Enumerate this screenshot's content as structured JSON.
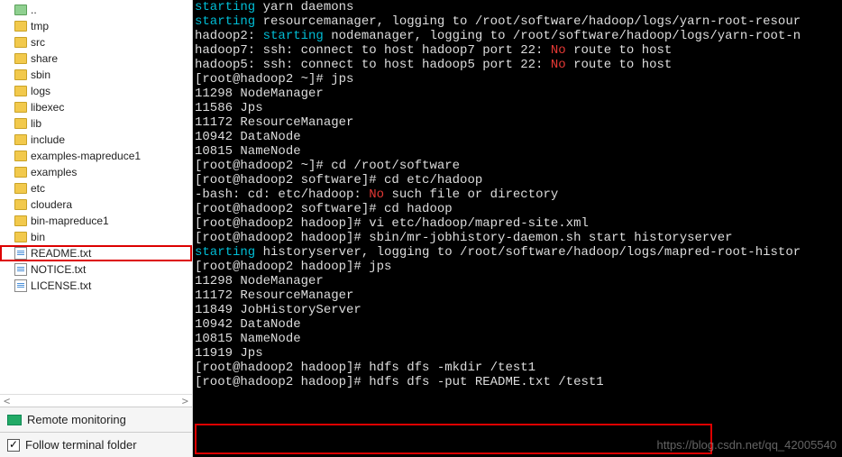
{
  "sidebar": {
    "items": [
      {
        "label": "..",
        "type": "up"
      },
      {
        "label": "tmp",
        "type": "folder"
      },
      {
        "label": "src",
        "type": "folder"
      },
      {
        "label": "share",
        "type": "folder"
      },
      {
        "label": "sbin",
        "type": "folder"
      },
      {
        "label": "logs",
        "type": "folder"
      },
      {
        "label": "libexec",
        "type": "folder"
      },
      {
        "label": "lib",
        "type": "folder"
      },
      {
        "label": "include",
        "type": "folder"
      },
      {
        "label": "examples-mapreduce1",
        "type": "folder"
      },
      {
        "label": "examples",
        "type": "folder"
      },
      {
        "label": "etc",
        "type": "folder"
      },
      {
        "label": "cloudera",
        "type": "folder"
      },
      {
        "label": "bin-mapreduce1",
        "type": "folder"
      },
      {
        "label": "bin",
        "type": "folder"
      },
      {
        "label": "README.txt",
        "type": "file",
        "highlighted": true
      },
      {
        "label": "NOTICE.txt",
        "type": "file"
      },
      {
        "label": "LICENSE.txt",
        "type": "file"
      }
    ]
  },
  "footer": {
    "remote_monitoring": "Remote monitoring",
    "follow_terminal": "Follow terminal folder"
  },
  "terminal_lines": [
    [
      {
        "t": "starting",
        "c": "cyan"
      },
      {
        "t": " yarn daemons",
        "c": "white"
      }
    ],
    [
      {
        "t": "starting",
        "c": "cyan"
      },
      {
        "t": " resourcemanager, logging to /root/software/hadoop/logs/yarn-root-resour",
        "c": "white"
      }
    ],
    [
      {
        "t": "hadoop2: ",
        "c": "white"
      },
      {
        "t": "starting",
        "c": "cyan"
      },
      {
        "t": " nodemanager, logging to /root/software/hadoop/logs/yarn-root-n",
        "c": "white"
      }
    ],
    [
      {
        "t": "hadoop7: ssh: connect to host hadoop7 port 22: ",
        "c": "white"
      },
      {
        "t": "No",
        "c": "red"
      },
      {
        "t": " route to host",
        "c": "white"
      }
    ],
    [
      {
        "t": "hadoop5: ssh: connect to host hadoop5 port 22: ",
        "c": "white"
      },
      {
        "t": "No",
        "c": "red"
      },
      {
        "t": " route to host",
        "c": "white"
      }
    ],
    [
      {
        "t": "[root@hadoop2 ~]# jps",
        "c": "white"
      }
    ],
    [
      {
        "t": "11298 NodeManager",
        "c": "white"
      }
    ],
    [
      {
        "t": "11586 Jps",
        "c": "white"
      }
    ],
    [
      {
        "t": "11172 ResourceManager",
        "c": "white"
      }
    ],
    [
      {
        "t": "10942 DataNode",
        "c": "white"
      }
    ],
    [
      {
        "t": "10815 NameNode",
        "c": "white"
      }
    ],
    [
      {
        "t": "[root@hadoop2 ~]# cd /root/software",
        "c": "white"
      }
    ],
    [
      {
        "t": "[root@hadoop2 software]# cd etc/hadoop",
        "c": "white"
      }
    ],
    [
      {
        "t": "-bash: cd: etc/hadoop: ",
        "c": "white"
      },
      {
        "t": "No",
        "c": "red"
      },
      {
        "t": " such file or directory",
        "c": "white"
      }
    ],
    [
      {
        "t": "[root@hadoop2 software]# cd hadoop",
        "c": "white"
      }
    ],
    [
      {
        "t": "[root@hadoop2 hadoop]# vi etc/hadoop/mapred-site.xml",
        "c": "white"
      }
    ],
    [
      {
        "t": "[root@hadoop2 hadoop]# sbin/mr-jobhistory-daemon.sh start historyserver",
        "c": "white"
      }
    ],
    [
      {
        "t": "starting",
        "c": "cyan"
      },
      {
        "t": " historyserver, logging to /root/software/hadoop/logs/mapred-root-histor",
        "c": "white"
      }
    ],
    [
      {
        "t": "[root@hadoop2 hadoop]# jps",
        "c": "white"
      }
    ],
    [
      {
        "t": "11298 NodeManager",
        "c": "white"
      }
    ],
    [
      {
        "t": "11172 ResourceManager",
        "c": "white"
      }
    ],
    [
      {
        "t": "11849 JobHistoryServer",
        "c": "white"
      }
    ],
    [
      {
        "t": "10942 DataNode",
        "c": "white"
      }
    ],
    [
      {
        "t": "10815 NameNode",
        "c": "white"
      }
    ],
    [
      {
        "t": "11919 Jps",
        "c": "white"
      }
    ],
    [
      {
        "t": "[root@hadoop2 hadoop]# hdfs dfs -mkdir /test1",
        "c": "white"
      }
    ],
    [
      {
        "t": "[root@hadoop2 hadoop]# hdfs dfs -put README.txt /test1",
        "c": "white"
      }
    ]
  ],
  "watermark": "https://blog.csdn.net/qq_42005540"
}
